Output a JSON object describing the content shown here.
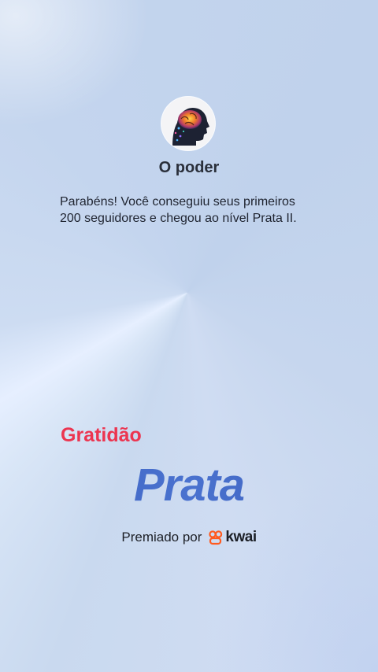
{
  "profile": {
    "avatar_icon": "brain-portrait-icon",
    "name": "O poder"
  },
  "message": {
    "line1": "Parabéns! Você conseguiu seus primeiros",
    "line2": "200 seguidores e chegou ao nível Prata II."
  },
  "badge": {
    "label": "Gratidão",
    "label_color": "#ec3550",
    "level": "Prata",
    "level_color": "#3e63c2"
  },
  "award": {
    "prefix": "Premiado por",
    "brand_icon": "kwai-logo-icon",
    "brand": "kwai",
    "brand_color": "#ff5a1f"
  }
}
